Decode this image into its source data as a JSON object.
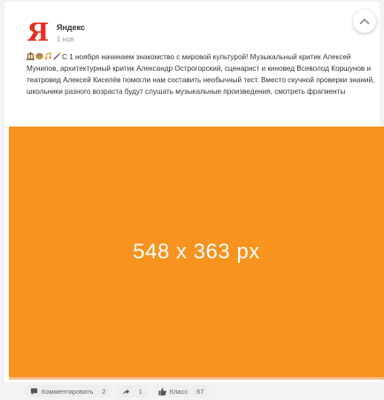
{
  "post": {
    "author": "Яндекс",
    "date": "1 ноя",
    "text": "С 1 ноября начинаем знакомство с мировой культурой! Музыкальный критик Алексей Мунипов, архитектурный критик Александр Острогорский, сценарист и киновед Всеволод Коршунов и театровед Алексей Киселёв помогли нам составить необычный тест. Вместо скучной проверки знаний, школьники разного возраста будут слушать музыкальные произведения, смотреть фрагменты",
    "logo_letter": "Я"
  },
  "media": {
    "label": "548 x  363 px",
    "color": "#f7931e"
  },
  "actions": {
    "comment_label": "Комментировать",
    "comment_count": "2",
    "share_count": "1",
    "like_label": "Класс",
    "like_count": "67"
  },
  "colors": {
    "brand_red": "#e62d1e",
    "media_orange": "#f7931e"
  }
}
